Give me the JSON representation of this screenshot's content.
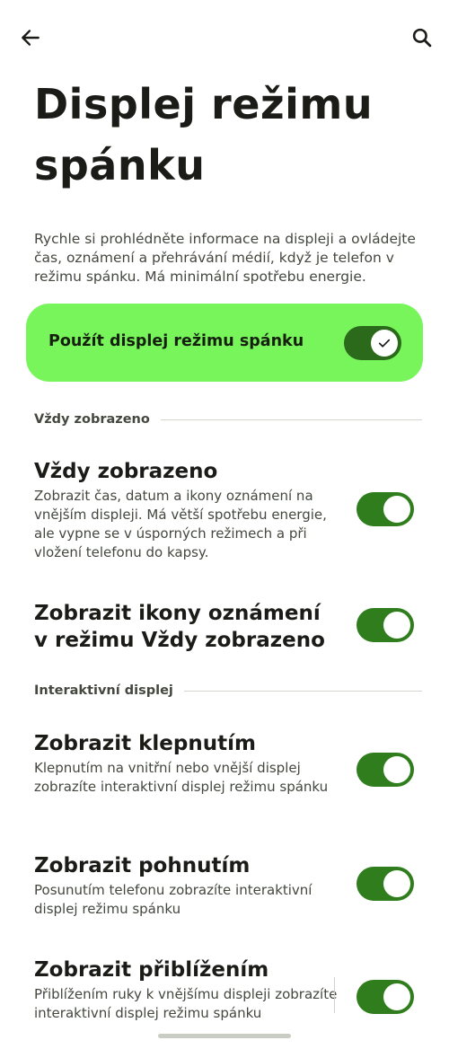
{
  "header": {
    "back_icon": "arrow-left-icon",
    "search_icon": "search-icon"
  },
  "page": {
    "title": "Displej režimu spánku",
    "intro": "Rychle si prohlédněte informace na displeji a ovládejte čas, oznámení a přehrávání médií, když je telefon v režimu spánku. Má minimální spotřebu energie."
  },
  "master": {
    "label": "Použít displej režimu spánku",
    "enabled": true
  },
  "sections": {
    "always_on": "Vždy zobrazeno",
    "interactive": "Interaktivní displej"
  },
  "settings": {
    "always_on": {
      "title": "Vždy zobrazeno",
      "desc": "Zobrazit čas, datum a ikony oznámení na vnějším displeji. Má větší spotřebu energie, ale vypne se v úsporných režimech a při vložení telefonu do kapsy.",
      "enabled": true
    },
    "show_icons": {
      "title": "Zobrazit ikony oznámení v režimu Vždy zobrazeno",
      "enabled": true
    },
    "tap": {
      "title": "Zobrazit klepnutím",
      "desc": "Klepnutím na vnitřní nebo vnější displej zobrazíte interaktivní displej režimu spánku",
      "enabled": true
    },
    "motion": {
      "title": "Zobrazit pohnutím",
      "desc": "Posunutím telefonu zobrazíte interaktivní displej režimu spánku",
      "enabled": true
    },
    "proximity": {
      "title": "Zobrazit přiblížením",
      "desc": "Přiblížením ruky k vnějšímu displeji zobrazíte interaktivní displej režimu spánku",
      "enabled": true
    }
  },
  "colors": {
    "accent": "#79f55c",
    "switch_on": "#2f7d1c"
  }
}
